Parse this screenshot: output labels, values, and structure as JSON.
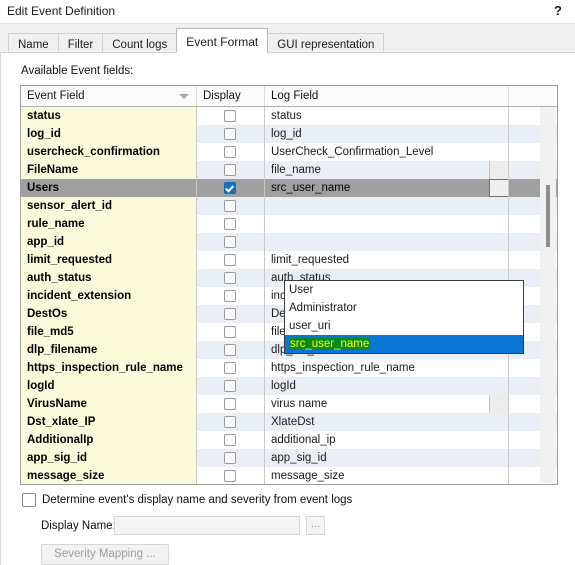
{
  "window": {
    "title": "Edit Event Definition",
    "help_label": "?"
  },
  "tabs": [
    {
      "label": "Name",
      "active": false
    },
    {
      "label": "Filter",
      "active": false
    },
    {
      "label": "Count logs",
      "active": false
    },
    {
      "label": "Event Format",
      "active": true
    },
    {
      "label": "GUI representation",
      "active": false
    }
  ],
  "main": {
    "section_label": "Available Event fields:",
    "columns": [
      "Event Field",
      "Display",
      "Log Field",
      ""
    ],
    "rows": [
      {
        "event_field": "status",
        "display": false,
        "log_field": "status"
      },
      {
        "event_field": "log_id",
        "display": false,
        "log_field": "log_id"
      },
      {
        "event_field": "usercheck_confirmation",
        "display": false,
        "log_field": "UserCheck_Confirmation_Level"
      },
      {
        "event_field": "FileName",
        "display": false,
        "log_field": "file_name",
        "has_editor": true
      },
      {
        "event_field": "Users",
        "display": true,
        "log_field": "src_user_name",
        "selected": true,
        "has_editor": true
      },
      {
        "event_field": "sensor_alert_id",
        "display": false,
        "log_field": ""
      },
      {
        "event_field": "rule_name",
        "display": false,
        "log_field": ""
      },
      {
        "event_field": "app_id",
        "display": false,
        "log_field": ""
      },
      {
        "event_field": "limit_requested",
        "display": false,
        "log_field": "limit_requested"
      },
      {
        "event_field": "auth_status",
        "display": false,
        "log_field": "auth_status"
      },
      {
        "event_field": "incident_extension",
        "display": false,
        "log_field": "incident_extension"
      },
      {
        "event_field": "DestOs",
        "display": false,
        "log_field": "Destination OS"
      },
      {
        "event_field": "file_md5",
        "display": false,
        "log_field": "file_md5"
      },
      {
        "event_field": "dlp_filename",
        "display": false,
        "log_field": "dlp_file_name"
      },
      {
        "event_field": "https_inspection_rule_name",
        "display": false,
        "log_field": "https_inspection_rule_name"
      },
      {
        "event_field": "logId",
        "display": false,
        "log_field": "logId"
      },
      {
        "event_field": "VirusName",
        "display": false,
        "log_field": "virus name",
        "has_editor": true
      },
      {
        "event_field": "Dst_xlate_IP",
        "display": false,
        "log_field": "XlateDst"
      },
      {
        "event_field": "AdditionalIp",
        "display": false,
        "log_field": "additional_ip"
      },
      {
        "event_field": "app_sig_id",
        "display": false,
        "log_field": "app_sig_id"
      },
      {
        "event_field": "message_size",
        "display": false,
        "log_field": "message_size"
      },
      {
        "event_field": "",
        "display": false,
        "log_field": ""
      }
    ],
    "dropdown": {
      "open": true,
      "options": [
        "User",
        "Administrator",
        "user_uri",
        "src_user_name"
      ],
      "selected": "src_user_name"
    }
  },
  "footer": {
    "determine_checkbox_label": "Determine event's display name and severity from event logs",
    "determine_checked": false,
    "display_name_label": "Display Name:",
    "display_name_value": "",
    "browse_label": "...",
    "severity_mapping_label": "Severity Mapping ..."
  },
  "colors": {
    "event_field_bg": "#fbfbdc",
    "alt_row_bg": "#eaeff5",
    "selected_row_bg": "#a0a0a0",
    "checkbox_on": "#1274c8",
    "dropdown_selected_bg": "#0b77d4",
    "dropdown_selected_text_bg": "#0b8a1e",
    "dropdown_selected_text": "#ffff00"
  }
}
